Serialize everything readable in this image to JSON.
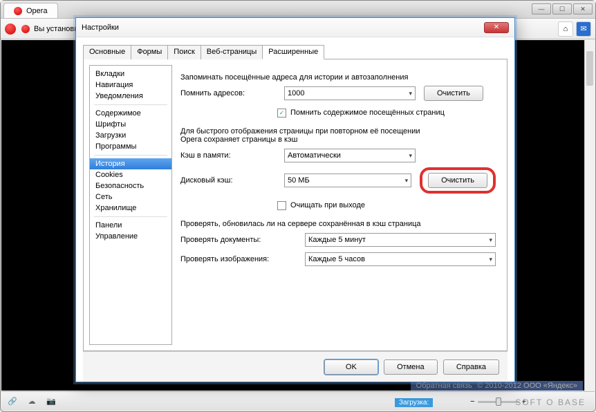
{
  "browser": {
    "tab_title": "Opera",
    "addr_text": "Вы установи",
    "win_min": "—",
    "win_max": "☐",
    "win_close": "✕"
  },
  "status": {
    "copyright": "© 2010-2012  ООО «Яндекс»",
    "feedback": "Обратная связь",
    "loading": "Загрузка:",
    "brand": "SOFT O BASE"
  },
  "dialog": {
    "title": "Настройки",
    "tabs": [
      "Основные",
      "Формы",
      "Поиск",
      "Веб-страницы",
      "Расширенные"
    ],
    "active_tab": 4,
    "sidebar": [
      {
        "label": "Вкладки"
      },
      {
        "label": "Навигация"
      },
      {
        "label": "Уведомления"
      },
      {
        "sep": true
      },
      {
        "label": "Содержимое"
      },
      {
        "label": "Шрифты"
      },
      {
        "label": "Загрузки"
      },
      {
        "label": "Программы"
      },
      {
        "sep": true
      },
      {
        "label": "История",
        "selected": true
      },
      {
        "label": "Cookies"
      },
      {
        "label": "Безопасность"
      },
      {
        "label": "Сеть"
      },
      {
        "label": "Хранилище"
      },
      {
        "sep": true
      },
      {
        "label": "Панели"
      },
      {
        "label": "Управление"
      }
    ],
    "pane": {
      "remember_intro": "Запоминать посещённые адреса для истории и автозаполнения",
      "remember_label": "Помнить адресов:",
      "remember_value": "1000",
      "clear1": "Очистить",
      "remember_content_chk": true,
      "remember_content_label": "Помнить содержимое посещённых страниц",
      "cache_intro1": "Для быстрого отображения страницы при повторном её посещении",
      "cache_intro2": "Opera сохраняет страницы в кэш",
      "mem_cache_label": "Кэш в памяти:",
      "mem_cache_value": "Автоматически",
      "disk_cache_label": "Дисковый кэш:",
      "disk_cache_value": "50 МБ",
      "clear2": "Очистить",
      "clear_on_exit_chk": false,
      "clear_on_exit_label": "Очищать при выходе",
      "check_intro": "Проверять, обновилась ли на сервере сохранённая в кэш страница",
      "check_docs_label": "Проверять документы:",
      "check_docs_value": "Каждые 5 минут",
      "check_imgs_label": "Проверять изображения:",
      "check_imgs_value": "Каждые 5 часов"
    },
    "footer": {
      "ok": "OK",
      "cancel": "Отмена",
      "help": "Справка"
    }
  }
}
